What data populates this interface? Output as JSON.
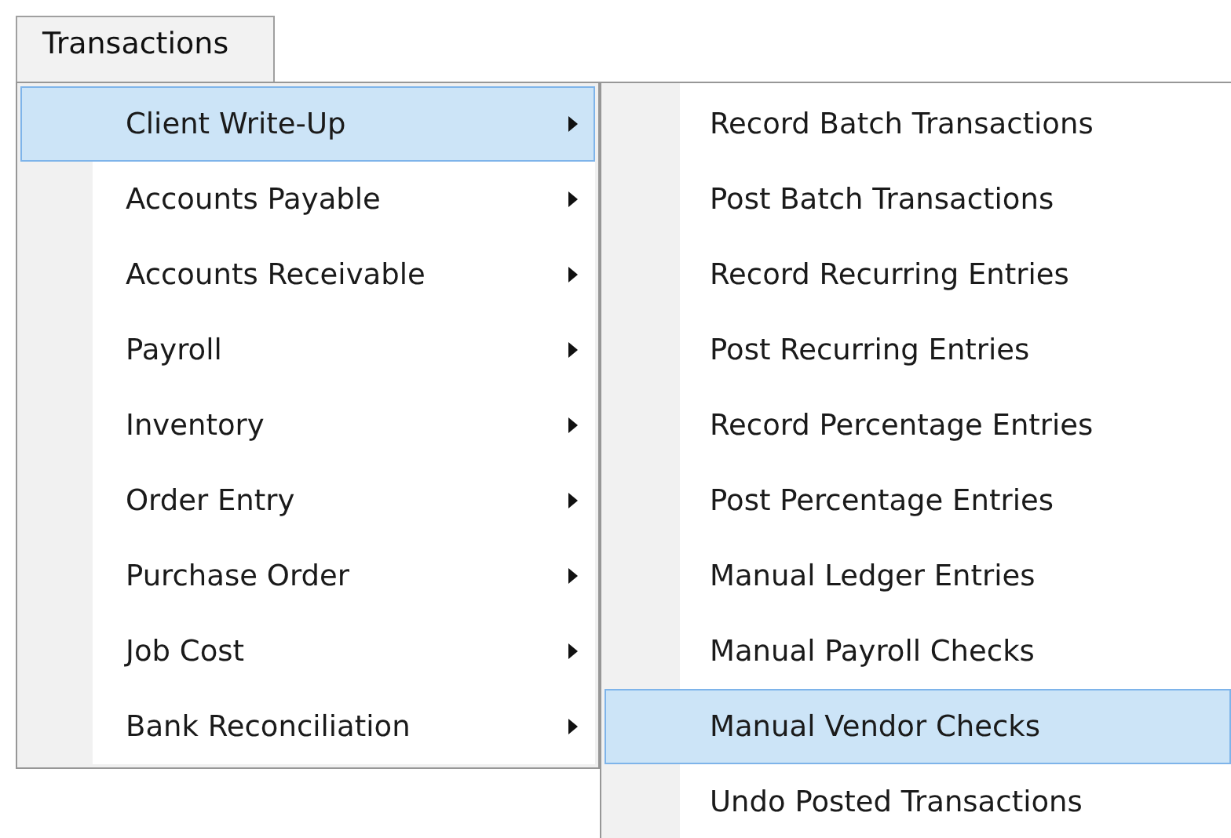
{
  "menu_bar": [
    {
      "label": "Transactions",
      "selected": true
    }
  ],
  "menu": {
    "items": [
      {
        "label": "Client Write-Up",
        "selected": true,
        "has_submenu": true
      },
      {
        "label": "Accounts Payable",
        "selected": false,
        "has_submenu": true
      },
      {
        "label": "Accounts Receivable",
        "selected": false,
        "has_submenu": true
      },
      {
        "label": "Payroll",
        "selected": false,
        "has_submenu": true
      },
      {
        "label": "Inventory",
        "selected": false,
        "has_submenu": true
      },
      {
        "label": "Order Entry",
        "selected": false,
        "has_submenu": true
      },
      {
        "label": "Purchase Order",
        "selected": false,
        "has_submenu": true
      },
      {
        "label": "Job Cost",
        "selected": false,
        "has_submenu": true
      },
      {
        "label": "Bank Reconciliation",
        "selected": false,
        "has_submenu": true
      }
    ]
  },
  "submenu": {
    "items": [
      {
        "label": "Record Batch Transactions",
        "selected": false
      },
      {
        "label": "Post Batch Transactions",
        "selected": false
      },
      {
        "label": "Record Recurring Entries",
        "selected": false
      },
      {
        "label": "Post Recurring Entries",
        "selected": false
      },
      {
        "label": "Record Percentage Entries",
        "selected": false
      },
      {
        "label": "Post Percentage Entries",
        "selected": false
      },
      {
        "label": "Manual Ledger Entries",
        "selected": false
      },
      {
        "label": "Manual Payroll Checks",
        "selected": false
      },
      {
        "label": "Manual Vendor Checks",
        "selected": true
      },
      {
        "label": "Undo Posted Transactions",
        "selected": false
      }
    ]
  }
}
